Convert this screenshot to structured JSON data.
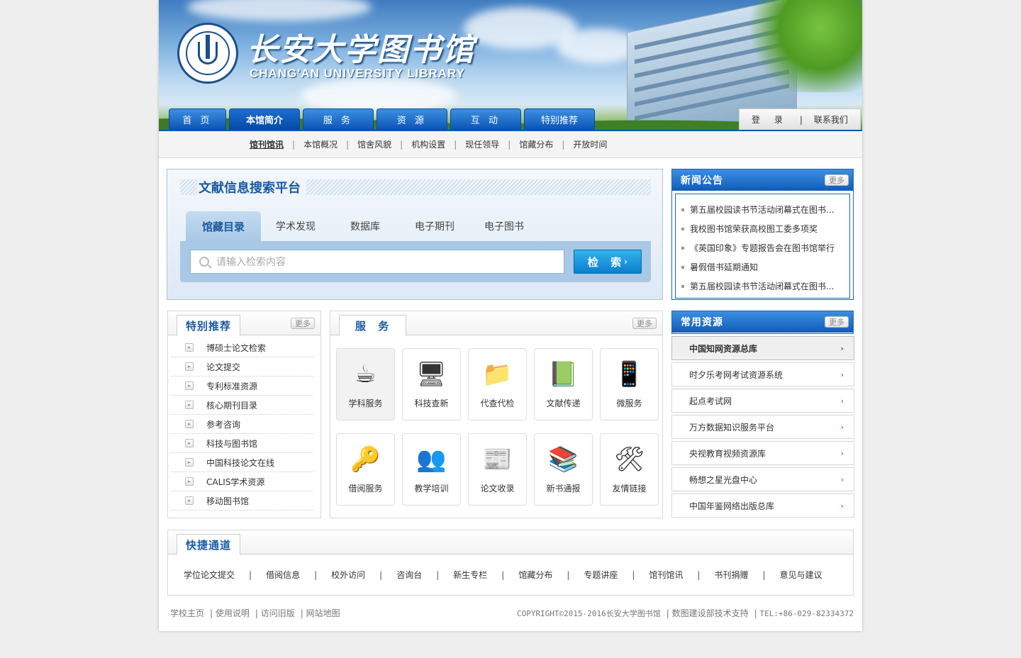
{
  "header": {
    "logo_cn": "长安大学图书馆",
    "logo_en": "CHANG'AN UNIVERSITY LIBRARY"
  },
  "nav": {
    "items": [
      "首 页",
      "本馆简介",
      "服 务",
      "资 源",
      "互 动",
      "特别推荐"
    ],
    "active": "本馆简介",
    "login": "登 录",
    "contact": "联系我们"
  },
  "subnav": {
    "items": [
      "馆刊馆讯",
      "本馆概况",
      "馆舍风貌",
      "机构设置",
      "现任领导",
      "馆藏分布",
      "开放时间"
    ],
    "current": "馆刊馆讯"
  },
  "search": {
    "title": "文献信息搜索平台",
    "tabs": [
      "馆藏目录",
      "学术发现",
      "数据库",
      "电子期刊",
      "电子图书"
    ],
    "active_tab": "馆藏目录",
    "placeholder": "请输入检索内容",
    "button": "检 索"
  },
  "news": {
    "title": "新闻公告",
    "more": "更多",
    "items": [
      "第五届校园读书节活动闭幕式在图书...",
      "我校图书馆荣获高校图工委多项奖",
      "《英国印象》专题报告会在图书馆举行",
      "暑假借书延期通知",
      "第五届校园读书节活动闭幕式在图书..."
    ]
  },
  "recommend": {
    "title": "特别推荐",
    "more": "更多",
    "items": [
      "博硕士论文检索",
      "论文提交",
      "专利标准资源",
      "核心期刊目录",
      "参考咨询",
      "科技与图书馆",
      "中国科技论文在线",
      "CALIS学术资源",
      "移动图书馆"
    ]
  },
  "services": {
    "title": "服 务",
    "more": "更多",
    "items": [
      {
        "label": "学科服务",
        "icon": "teacup-documents-icon"
      },
      {
        "label": "科技查新",
        "icon": "monitor-gear-icon"
      },
      {
        "label": "代查代检",
        "icon": "folder-gear-icon"
      },
      {
        "label": "文献传递",
        "icon": "books-icon"
      },
      {
        "label": "微服务",
        "icon": "mobile-phone-icon"
      },
      {
        "label": "借阅服务",
        "icon": "key-card-icon"
      },
      {
        "label": "教学培训",
        "icon": "users-icon"
      },
      {
        "label": "论文收录",
        "icon": "newspaper-icon"
      },
      {
        "label": "新书通报",
        "icon": "book-stack-icon"
      },
      {
        "label": "友情链接",
        "icon": "tools-icon"
      }
    ]
  },
  "resources": {
    "title": "常用资源",
    "more": "更多",
    "items": [
      "中国知网资源总库",
      "时夕乐考网考试资源系统",
      "起点考试网",
      "万方数据知识服务平台",
      "央视教育视频资源库",
      "畅想之星光盘中心",
      "中国年鉴网络出版总库"
    ]
  },
  "quick": {
    "title": "快捷通道",
    "links": [
      "学位论文提交",
      "借阅信息",
      "校外访问",
      "咨询台",
      "新生专栏",
      "馆藏分布",
      "专题讲座",
      "馆刊馆讯",
      "书刊捐赠",
      "意见与建议"
    ]
  },
  "footer": {
    "left": [
      "学校主页",
      "使用说明",
      "访问旧版",
      "网站地图"
    ],
    "copyright": "COPYRIGHT©2015-2016长安大学图书馆",
    "support": "数图建设部技术支持",
    "tel": "TEL:+86-029-82334372"
  }
}
